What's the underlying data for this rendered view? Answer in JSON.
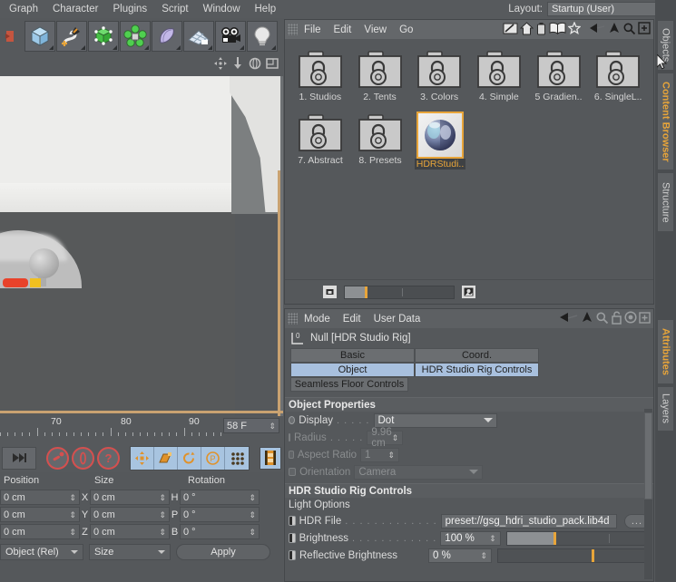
{
  "app": {
    "menu": [
      "Graph",
      "Character",
      "Plugins",
      "Script",
      "Window",
      "Help"
    ],
    "layout_label": "Layout:",
    "layout_value": "Startup (User)"
  },
  "toolbar": {
    "buttons": [
      {
        "name": "cube-icon",
        "label": "Cube"
      },
      {
        "name": "spline-pen-icon",
        "label": "Spline Pen"
      },
      {
        "name": "hypernurbs-icon",
        "label": "HyperNURBS"
      },
      {
        "name": "array-icon",
        "label": "Array"
      },
      {
        "name": "bend-deformer-icon",
        "label": "Bend"
      },
      {
        "name": "floor-environment-icon",
        "label": "Floor"
      },
      {
        "name": "camera-icon",
        "label": "Camera"
      },
      {
        "name": "light-icon",
        "label": "Light"
      }
    ]
  },
  "viewport": {
    "header_icons": [
      "move-view-icon",
      "scale-view-icon",
      "rotate-view-icon",
      "maximize-view-icon"
    ]
  },
  "timeline": {
    "ticks": [
      "70",
      "80",
      "90"
    ],
    "frame_value": "58 F"
  },
  "anim_toolbar": {
    "buttons": [
      {
        "name": "goto-end-icon",
        "label": "Go to End"
      },
      {
        "name": "record-position-icon",
        "label": "Record Position"
      },
      {
        "name": "autokeying-icon",
        "label": "Autokeying"
      },
      {
        "name": "keyframe-selection-icon",
        "label": "Keyframe Selection"
      },
      {
        "name": "position-key-icon",
        "label": "Position"
      },
      {
        "name": "scale-key-icon",
        "label": "Scale"
      },
      {
        "name": "rotation-key-icon",
        "label": "Rotation"
      },
      {
        "name": "parameter-key-icon",
        "label": "Parameter"
      },
      {
        "name": "point-level-anim-icon",
        "label": "PLA"
      },
      {
        "name": "timeline-icon",
        "label": "Timeline"
      }
    ]
  },
  "coordinates": {
    "headers": [
      "Position",
      "Size",
      "Rotation"
    ],
    "rows": [
      {
        "axis1": "X",
        "pos": "0 cm",
        "size": "0 cm",
        "axis2": "H",
        "rot": "0 °"
      },
      {
        "axis1": "Y",
        "pos": "0 cm",
        "size": "0 cm",
        "axis2": "P",
        "rot": "0 °"
      },
      {
        "axis1": "Z",
        "pos": "0 cm",
        "size": "0 cm",
        "axis2": "B",
        "rot": "0 °"
      }
    ],
    "mode_dropdown": "Object (Rel)",
    "size_dropdown": "Size",
    "apply_label": "Apply"
  },
  "content_browser": {
    "menu": [
      "File",
      "Edit",
      "View",
      "Go"
    ],
    "toolbar_icons": [
      "edit-preview-icon",
      "home-icon",
      "trash-icon",
      "catalog-icon",
      "favorites-star-icon",
      "back-arrow-icon",
      "up-arrow-icon",
      "search-icon",
      "new-folder-icon"
    ],
    "items": [
      {
        "label": "1. Studios",
        "icon": "locked-case-icon",
        "selected": false
      },
      {
        "label": "2. Tents",
        "icon": "locked-case-icon",
        "selected": false
      },
      {
        "label": "3. Colors",
        "icon": "locked-case-icon",
        "selected": false
      },
      {
        "label": "4. Simple",
        "icon": "locked-case-icon",
        "selected": false
      },
      {
        "label": "5 Gradien..",
        "icon": "locked-case-icon",
        "selected": false
      },
      {
        "label": "6. SingleL..",
        "icon": "locked-case-icon",
        "selected": false
      },
      {
        "label": "7. Abstract",
        "icon": "locked-case-icon",
        "selected": false
      },
      {
        "label": "8. Presets",
        "icon": "locked-case-icon",
        "selected": false
      },
      {
        "label": "HDRStudi..",
        "icon": "material-sphere-thumb",
        "selected": true
      }
    ],
    "footer": {
      "small_thumb_icon": "small-preview-icon",
      "large_thumb_icon": "large-preview-icon",
      "zoom_value": 18
    }
  },
  "attributes": {
    "menu": [
      "Mode",
      "Edit",
      "User Data"
    ],
    "toolbar_icons": [
      "back-arrow-icon",
      "up-arrow-icon",
      "search-icon",
      "lock-icon",
      "target-icon",
      "new-tab-icon"
    ],
    "object_title": "Null [HDR Studio Rig]",
    "object_icon": "null-object-icon",
    "tabs_row1": [
      {
        "label": "Basic",
        "active": false
      },
      {
        "label": "Coord.",
        "active": false
      }
    ],
    "tabs_row2": [
      {
        "label": "Object",
        "active": true
      },
      {
        "label": "HDR Studio Rig Controls",
        "active": true
      }
    ],
    "tabs_row3": [
      {
        "label": "Seamless Floor Controls",
        "active": false
      }
    ],
    "object_properties": {
      "title": "Object Properties",
      "rows": [
        {
          "label": "Display",
          "dots": ". . . . .",
          "value": "Dot",
          "type": "dropdown",
          "enabled": true
        },
        {
          "label": "Radius",
          "dots": ". . . . .",
          "value": "9.96 cm",
          "type": "spinner",
          "enabled": false
        },
        {
          "label": "Aspect Ratio",
          "dots": "",
          "value": "1",
          "type": "spinner",
          "enabled": false
        },
        {
          "label": "Orientation",
          "dots": "",
          "value": "Camera",
          "type": "dropdown",
          "enabled": false
        }
      ]
    },
    "hdr_controls": {
      "title": "HDR Studio Rig Controls",
      "subtitle": "Light Options",
      "rows": [
        {
          "label": "HDR File",
          "dots": ". . . . . . . . . . . . .",
          "value": "preset://gsg_hdri_studio_pack.lib4d",
          "type": "file",
          "button": "..."
        },
        {
          "label": "Brightness",
          "dots": ". . . . . . . . . . . .",
          "value": "100 %",
          "type": "slider",
          "fill": 33,
          "mark": 33,
          "tick": 72
        },
        {
          "label": "Reflective Brightness",
          "dots": "",
          "value": "0 %",
          "type": "slider",
          "fill": 0,
          "mark": 62,
          "tick": 0
        }
      ]
    }
  },
  "side_tabs": [
    {
      "label": "Objects",
      "active": false
    },
    {
      "label": "Content Browser",
      "active": true
    },
    {
      "label": "Structure",
      "active": false
    },
    {
      "label": "Attributes",
      "active": true
    },
    {
      "label": "Layers",
      "active": false
    }
  ],
  "colors": {
    "accent_orange": "#e8a53a",
    "tab_blue": "#a8c0de",
    "panel_bg": "#55585b",
    "chrome_bg": "#56595c",
    "viewport_floor": "#57595a"
  }
}
